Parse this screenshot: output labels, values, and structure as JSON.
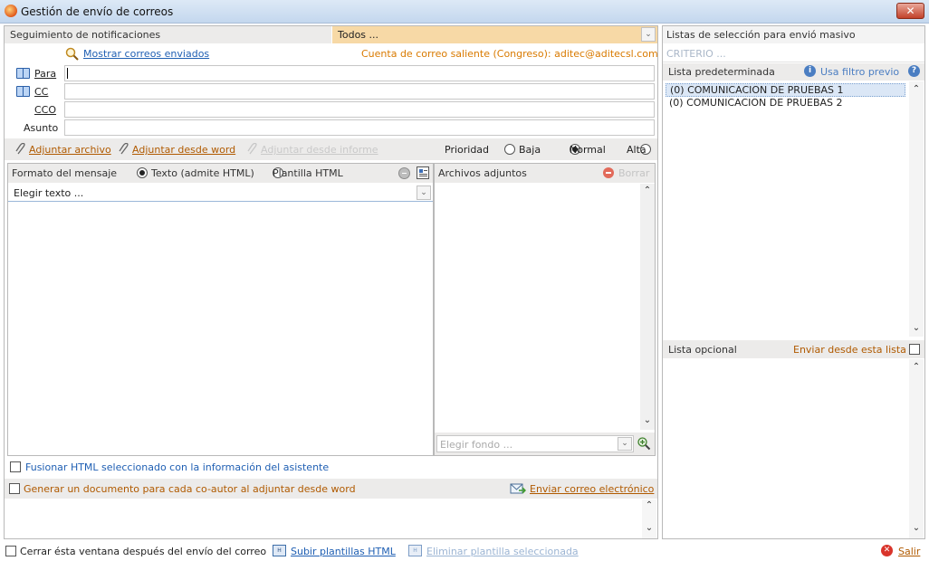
{
  "window": {
    "title": "Gestión de envío de correos",
    "close_symbol": "✕"
  },
  "tracking": {
    "label": "Seguimiento de notificaciones",
    "filter_value": "Todos ..."
  },
  "mail": {
    "show_sent_link": "Mostrar correos enviados",
    "outgoing_account": "Cuenta de correo saliente (Congreso): aditec@aditecsl.com",
    "to_label": "Para",
    "cc_label": "CC",
    "bcc_label": "CCO",
    "subject_label": "Asunto",
    "to_value": "",
    "cc_value": "",
    "bcc_value": "",
    "subject_value": ""
  },
  "attach_bar": {
    "attach_file": "Adjuntar archivo",
    "attach_word": "Adjuntar desde word",
    "attach_report": "Adjuntar desde informe",
    "priority_label": "Prioridad",
    "priority_options": [
      "Baja",
      "Normal",
      "Alta"
    ],
    "priority_selected": "Normal"
  },
  "message": {
    "format_label": "Formato del mensaje",
    "format_text": "Texto (admite HTML)",
    "format_template": "Plantilla HTML",
    "format_selected": "Texto (admite HTML)",
    "choose_text_placeholder": "Elegir texto ..."
  },
  "attachments": {
    "label": "Archivos adjuntos",
    "delete_label": "Borrar",
    "choose_background_placeholder": "Elegir fondo ..."
  },
  "options": {
    "merge_html": "Fusionar HTML seleccionado con la información del asistente",
    "per_coauthor": "Generar un documento para cada co-autor al adjuntar desde word",
    "send_email": "Enviar correo electrónico",
    "close_after_send": "Cerrar ésta ventana después del envío del correo",
    "upload_templates": "Subir plantillas HTML",
    "delete_template": "Eliminar plantilla seleccionada",
    "exit": "Salir"
  },
  "lists": {
    "header": "Listas de selección para envió masivo",
    "criteria_placeholder": "CRITERIO ...",
    "default_list_label": "Lista predeterminada",
    "use_previous_filter": "Usa filtro previo",
    "default_list_items": [
      "(0) COMUNICACION DE PRUEBAS 1",
      "(0) COMUNICACION DE PRUEBAS 2"
    ],
    "optional_list_label": "Lista opcional",
    "send_from_list": "Enviar desde esta lista"
  },
  "colors": {
    "accent_orange": "#d97a00",
    "link_blue": "#1f5fb3",
    "link_brown": "#b05a00",
    "selection": "#dbe7f6"
  }
}
